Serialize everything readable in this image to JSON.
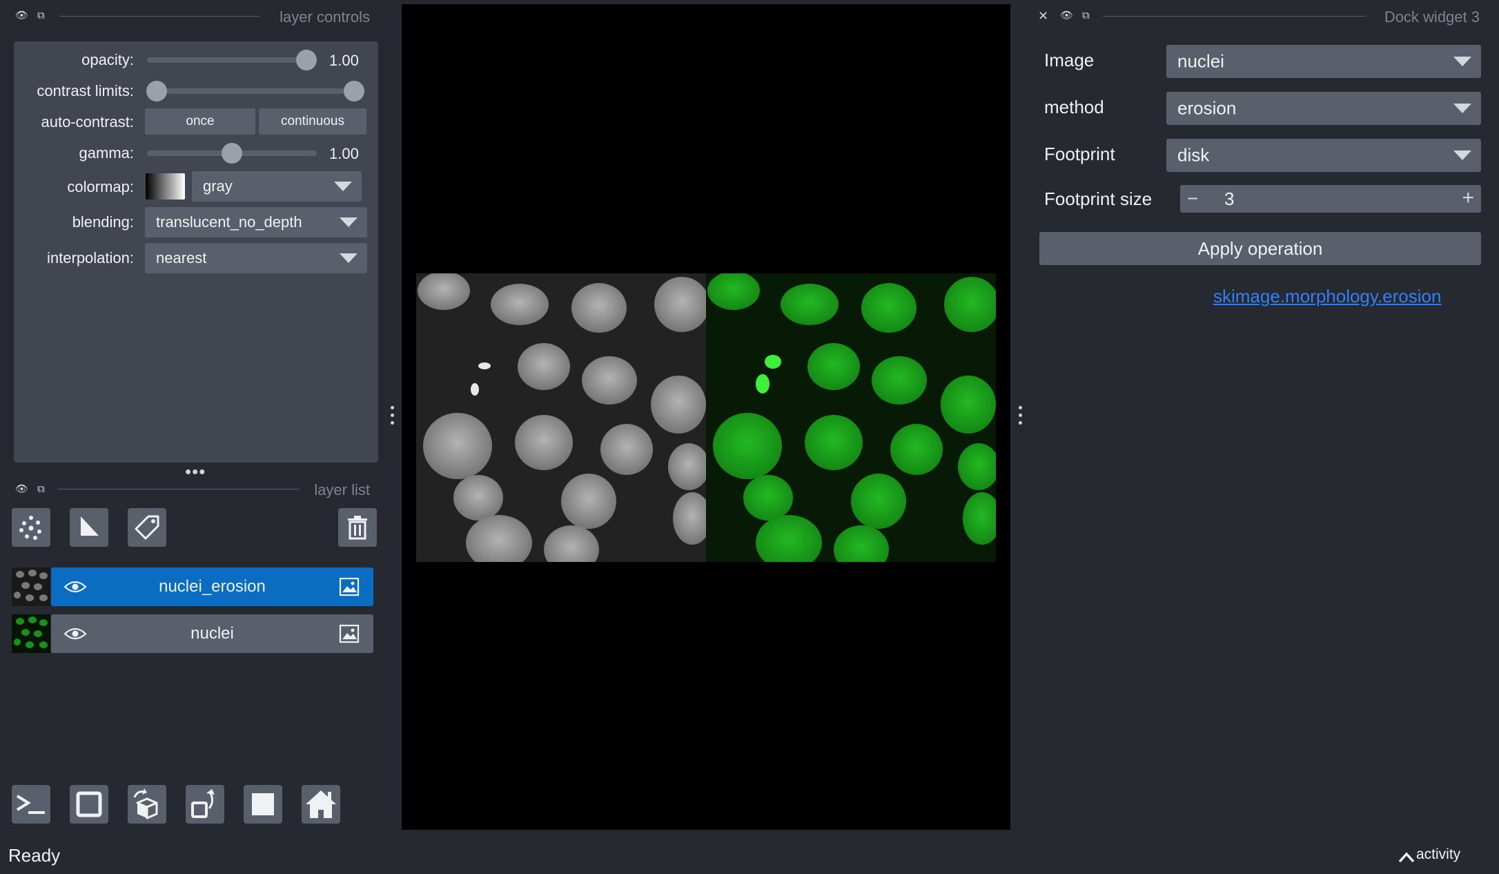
{
  "left_panel": {
    "controls_title": "layer controls",
    "opacity": {
      "label": "opacity:",
      "value": "1.00",
      "level": 1.0
    },
    "contrast_limits": {
      "label": "contrast limits:",
      "low": 0.0,
      "high": 1.0
    },
    "auto_contrast": {
      "label": "auto-contrast:",
      "once": "once",
      "continuous": "continuous"
    },
    "gamma": {
      "label": "gamma:",
      "value": "1.00",
      "level": 0.5
    },
    "colormap": {
      "label": "colormap:",
      "value": "gray"
    },
    "blending": {
      "label": "blending:",
      "value": "translucent_no_depth"
    },
    "interpolation": {
      "label": "interpolation:",
      "value": "nearest"
    },
    "list_title": "layer list",
    "layers": [
      {
        "name": "nuclei_erosion",
        "selected": true,
        "visible_icon": "eye-icon",
        "type_icon": "image-icon",
        "thumb_color": "#bfbfbf"
      },
      {
        "name": "nuclei",
        "selected": false,
        "visible_icon": "eye-icon",
        "type_icon": "image-icon",
        "thumb_color": "#22c022"
      }
    ],
    "layer_tools": [
      "points-icon",
      "shapes-icon",
      "labels-icon",
      "delete-icon"
    ],
    "viewer_buttons": [
      "console-icon",
      "ndisplay-square-icon",
      "rotate-3d-icon",
      "transpose-icon",
      "grid-icon",
      "home-icon"
    ]
  },
  "dock": {
    "title": "Dock widget 3",
    "image": {
      "label": "Image",
      "value": "nuclei"
    },
    "method": {
      "label": "method",
      "value": "erosion"
    },
    "footprint": {
      "label": "Footprint",
      "value": "disk"
    },
    "footprint_size": {
      "label": "Footprint size",
      "value": "3",
      "minus": "−",
      "plus": "+"
    },
    "apply_label": "Apply operation",
    "link": "skimage.morphology.erosion"
  },
  "status": {
    "text": "Ready",
    "activity": "activity"
  },
  "colors": {
    "background": "#262930",
    "panel": "#414651",
    "button": "#5a5f6c",
    "selected": "#0a6dc2",
    "link": "#2f81f7",
    "nuclei_green": "#22c022"
  }
}
